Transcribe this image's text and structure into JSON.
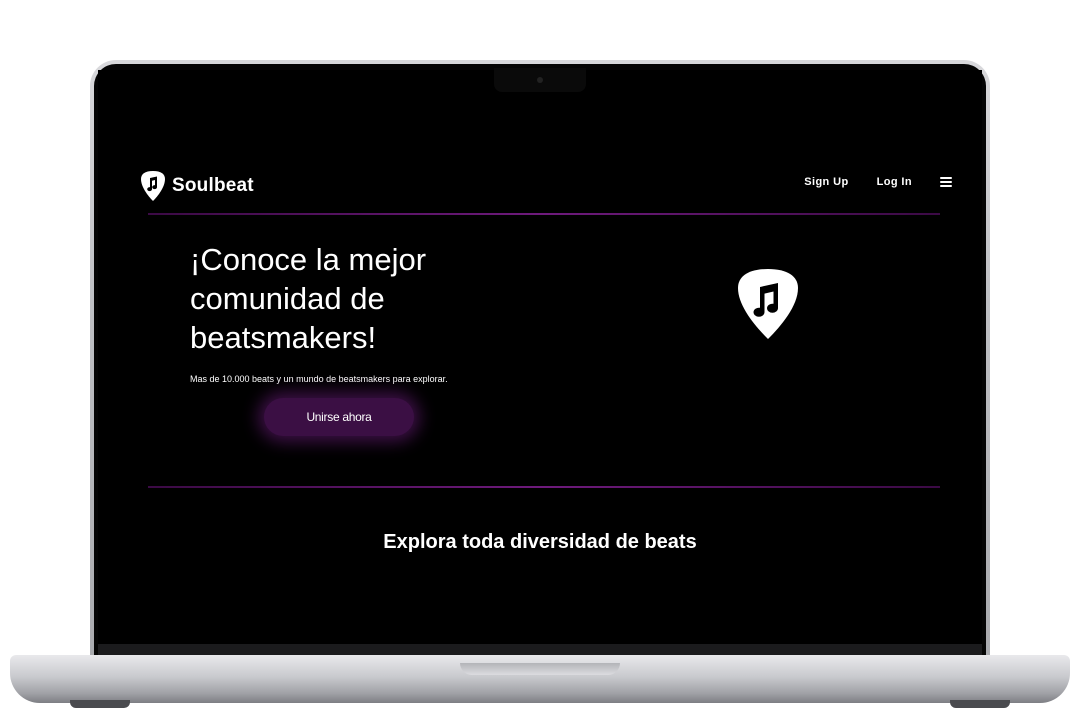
{
  "brand": {
    "name": "Soulbeat",
    "logo_icon": "guitar-pick-music-note-icon"
  },
  "nav": {
    "signup_label": "Sign Up",
    "login_label": "Log In",
    "menu_icon": "hamburger-menu-icon"
  },
  "hero": {
    "title": "¡Conoce la mejor comunidad de beatsmakers!",
    "subtitle": "Mas de 10.000 beats y un mundo de beatsmakers para explorar.",
    "cta_label": "Unirse ahora",
    "illustration_icon": "guitar-pick-music-note-icon"
  },
  "section": {
    "title": "Explora toda diversidad de beats"
  },
  "colors": {
    "background": "#000000",
    "accent": "#6e1a7c",
    "cta_background": "#3b0f44",
    "text": "#ffffff"
  }
}
